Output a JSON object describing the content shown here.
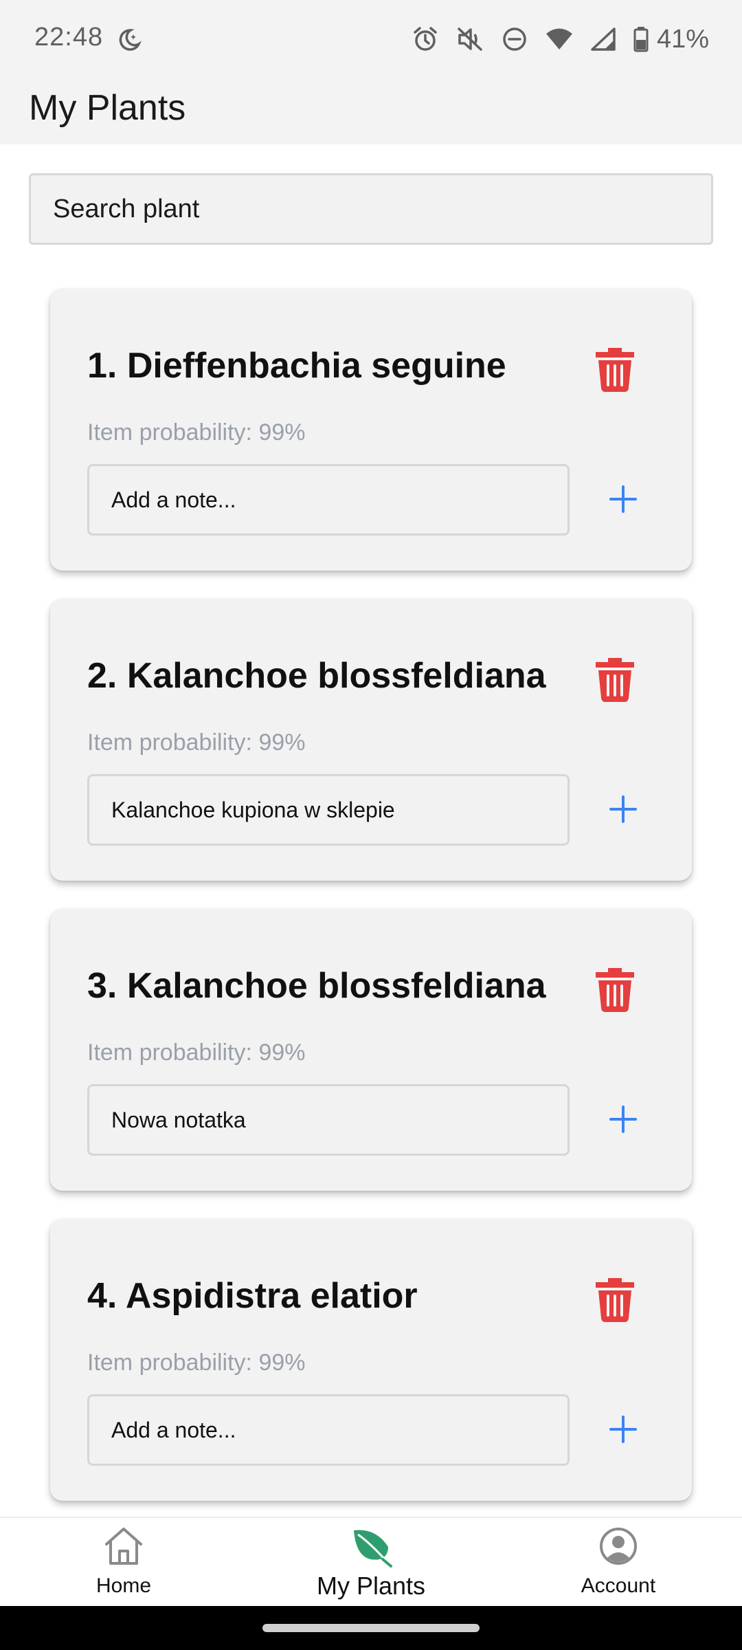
{
  "status_bar": {
    "time": "22:48",
    "battery": "41%",
    "icons": [
      "moon-icon",
      "alarm-icon",
      "vibrate-off-icon",
      "do-not-disturb-icon",
      "wifi-icon",
      "signal-icon",
      "battery-icon"
    ]
  },
  "header": {
    "title": "My Plants"
  },
  "search": {
    "placeholder": "Search plant"
  },
  "plants": [
    {
      "title": "1. Dieffenbachia seguine",
      "probability": "Item probability: 99%",
      "note_value": "",
      "note_placeholder": "Add a note..."
    },
    {
      "title": "2. Kalanchoe blossfeldiana",
      "probability": "Item probability: 99%",
      "note_value": "Kalanchoe kupiona w sklepie",
      "note_placeholder": "Add a note..."
    },
    {
      "title": "3. Kalanchoe blossfeldiana",
      "probability": "Item probability: 99%",
      "note_value": "Nowa notatka",
      "note_placeholder": "Add a note..."
    },
    {
      "title": "4. Aspidistra elatior",
      "probability": "Item probability: 99%",
      "note_value": "",
      "note_placeholder": "Add a note..."
    }
  ],
  "bottom_nav": {
    "items": [
      {
        "label": "Home",
        "icon": "home-icon",
        "active": false
      },
      {
        "label": "My Plants",
        "icon": "leaf-icon",
        "active": true
      },
      {
        "label": "Account",
        "icon": "account-icon",
        "active": false
      }
    ]
  },
  "colors": {
    "delete": "#e53e3e",
    "add": "#3b82f6",
    "active_nav": "#2f9e6e",
    "inactive_nav": "#8a8a8a",
    "probability_text": "#9aa0aa"
  }
}
